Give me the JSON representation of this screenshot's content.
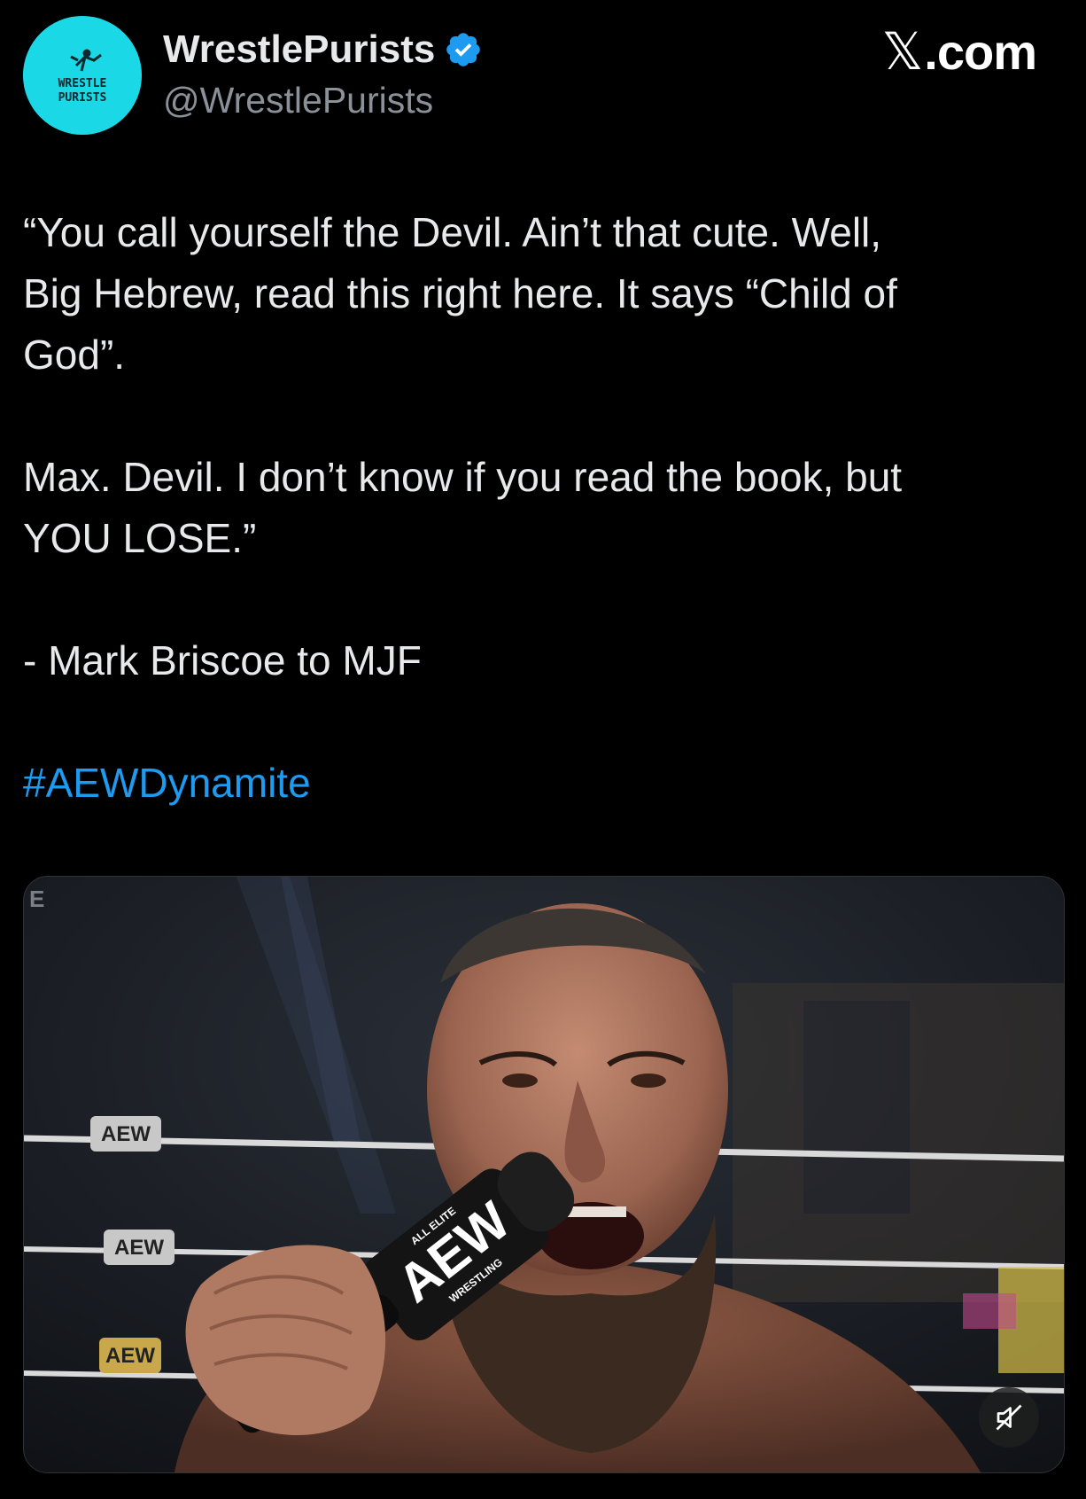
{
  "author": {
    "display_name": "WrestlePurists",
    "handle": "@WrestlePurists",
    "verified": true,
    "avatar_text": "WRESTLE\nPURISTS",
    "avatar_color": "#1ad8e6"
  },
  "site_label": {
    "x": "𝕏",
    "domain": ".com"
  },
  "tweet": {
    "paragraphs": [
      "“You call yourself the Devil. Ain’t that cute. Well,\nBig Hebrew, read this right here. It says “Child of\nGod”.",
      "Max. Devil. I don’t know if you read the book, but\nYOU LOSE.”",
      "- Mark Briscoe to MJF"
    ],
    "hashtag": "#AEWDynamite"
  },
  "media": {
    "type": "video",
    "mic_text": "AEW",
    "mic_small_top": "ALL ELITE",
    "mic_small_bottom": "WRESTLING",
    "ring_sign": "AEW",
    "corner_letter": "E",
    "controls": {
      "mute_icon": "speaker-muted-icon"
    }
  },
  "colors": {
    "background": "#000000",
    "text": "#e7e9ea",
    "handle": "#8b9199",
    "link": "#1d9bf0",
    "verified": "#1d9bf0"
  }
}
